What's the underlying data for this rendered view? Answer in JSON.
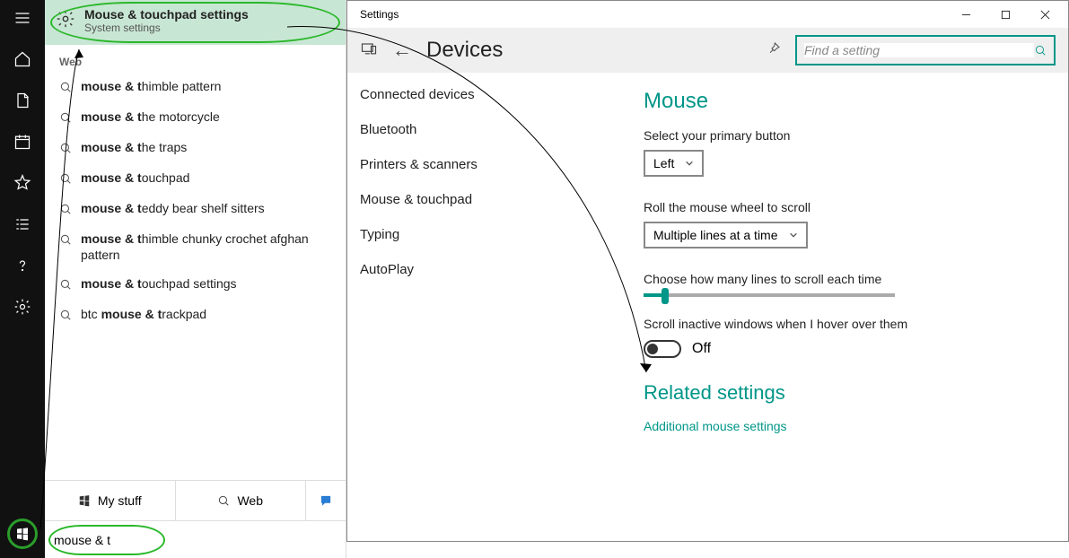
{
  "rail_icons": [
    "menu",
    "home",
    "browser",
    "calendar",
    "star",
    "list",
    "help",
    "gear"
  ],
  "best_match": {
    "title": "Mouse & touchpad settings",
    "subtitle": "System settings"
  },
  "web_section_label": "Web",
  "suggestions": [
    {
      "prefix": "mouse & t",
      "suffix": "himble pattern"
    },
    {
      "prefix": "mouse & t",
      "suffix": "he motorcycle"
    },
    {
      "prefix": "mouse & t",
      "suffix": "he traps"
    },
    {
      "prefix": "mouse & t",
      "suffix": "ouchpad"
    },
    {
      "prefix": "mouse & t",
      "suffix": "eddy bear shelf sitters"
    },
    {
      "prefix": "mouse & t",
      "suffix": "himble chunky crochet afghan pattern"
    },
    {
      "prefix": "mouse & t",
      "suffix": "ouchpad settings"
    },
    {
      "prefix_plain": "btc ",
      "bold": "mouse & t",
      "suffix": "rackpad"
    }
  ],
  "footer": {
    "mystuff": "My stuff",
    "web": "Web"
  },
  "search_query": "mouse & t",
  "settings": {
    "window_title": "Settings",
    "header_title": "Devices",
    "search_placeholder": "Find a setting",
    "nav": [
      "Connected devices",
      "Bluetooth",
      "Printers & scanners",
      "Mouse & touchpad",
      "Typing",
      "AutoPlay"
    ],
    "mouse_heading": "Mouse",
    "primary_label": "Select your primary button",
    "primary_value": "Left",
    "scroll_label": "Roll the mouse wheel to scroll",
    "scroll_value": "Multiple lines at a time",
    "lines_label": "Choose how many lines to scroll each time",
    "inactive_label": "Scroll inactive windows when I hover over them",
    "toggle_value": "Off",
    "related_heading": "Related settings",
    "related_link": "Additional mouse settings"
  }
}
